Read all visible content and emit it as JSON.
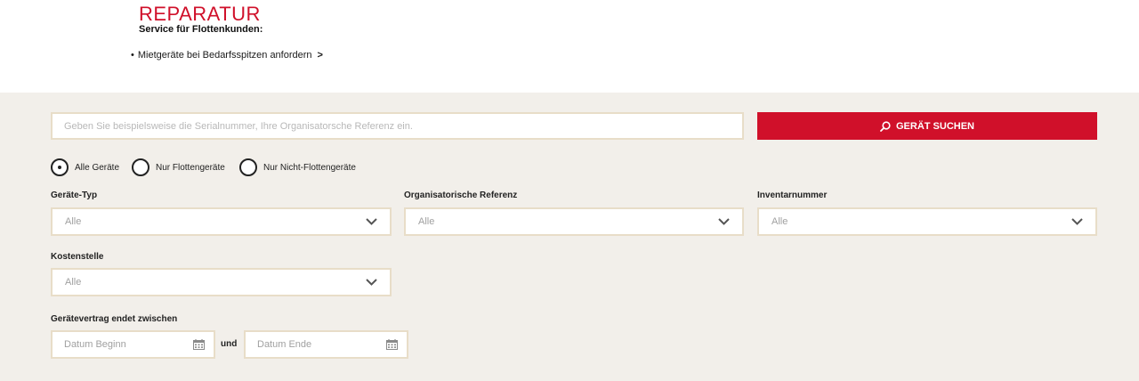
{
  "header": {
    "title": "REPARATUR",
    "subtitle": "Service für Flottenkunden:",
    "link_bullet": "•",
    "link_label": "Mietgeräte bei Bedarfsspitzen anfordern",
    "link_chevron": ">"
  },
  "search": {
    "placeholder": "Geben Sie beispielsweise die Serialnummer, Ihre Organisatorsche Referenz ein.",
    "button_label": "GERÄT SUCHEN"
  },
  "radios": [
    {
      "label": "Alle Geräte",
      "selected": true
    },
    {
      "label": "Nur Flottengeräte",
      "selected": false
    },
    {
      "label": "Nur Nicht-Flottengeräte",
      "selected": false
    }
  ],
  "filters": {
    "geraete_typ": {
      "label": "Geräte-Typ",
      "value": "Alle"
    },
    "org_referenz": {
      "label": "Organisatorische Referenz",
      "value": "Alle"
    },
    "inventarnummer": {
      "label": "Inventarnummer",
      "value": "Alle"
    },
    "kostenstelle": {
      "label": "Kostenstelle",
      "value": "Alle"
    }
  },
  "contract": {
    "label": "Gerätevertrag endet zwischen",
    "start_placeholder": "Datum Beginn",
    "connector": "und",
    "end_placeholder": "Datum Ende"
  },
  "colors": {
    "brand_red": "#d0102a",
    "panel_bg": "#f2efea",
    "field_border": "#e8ddc8"
  },
  "icons": {
    "search": "search-icon",
    "dropdown": "chevron-down-icon",
    "date": "calendar-icon"
  }
}
